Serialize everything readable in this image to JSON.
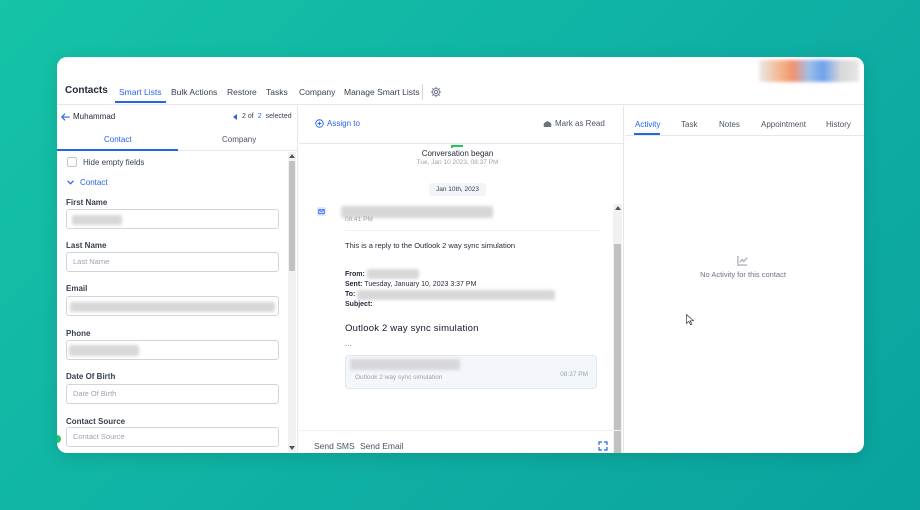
{
  "topnav": {
    "brand": "Contacts",
    "tabs": [
      {
        "label": "Smart Lists",
        "active": true
      },
      {
        "label": "Bulk Actions"
      },
      {
        "label": "Restore"
      },
      {
        "label": "Tasks"
      },
      {
        "label": "Company"
      },
      {
        "label": "Manage Smart Lists"
      }
    ],
    "settings_icon": "gear-icon"
  },
  "left": {
    "back_name": "Muhammad",
    "pager": {
      "current": "2 of",
      "total": "2",
      "selected": "selected"
    },
    "tabs": [
      {
        "label": "Contact",
        "active": true
      },
      {
        "label": "Company"
      }
    ],
    "hide_empty_label": "Hide empty fields",
    "section_label": "Contact",
    "fields": [
      {
        "label": "First Name",
        "value": "",
        "placeholder": ""
      },
      {
        "label": "Last Name",
        "value": "",
        "placeholder": "Last Name"
      },
      {
        "label": "Email",
        "value": "",
        "placeholder": ""
      },
      {
        "label": "Phone",
        "value": "",
        "placeholder": ""
      },
      {
        "label": "Date Of Birth",
        "value": "",
        "placeholder": "Date Of Birth"
      },
      {
        "label": "Contact Source",
        "value": "",
        "placeholder": "Contact Source"
      }
    ]
  },
  "middle": {
    "assign_label": "Assign to",
    "mark_read_label": "Mark as Read",
    "conversation_title": "Conversation began",
    "conversation_time": "Tue, Jan 10 2023, 08:37 PM",
    "date_pill": "Jan 10th, 2023",
    "message": {
      "time": "08:41 PM",
      "body": "This is a reply to the Outlook 2 way sync simulation",
      "from_label": "From:",
      "sent_label": "Sent:",
      "sent_value": "Tuesday, January 10, 2023 3:37 PM",
      "to_label": "To:",
      "subject_label": "Subject:",
      "subject_big": "Outlook 2 way sync simulation",
      "ellipsis": "...",
      "quote_subject": "Outlook 2 way sync simulation",
      "quote_time": "08:37 PM"
    },
    "send_sms": "Send SMS",
    "send_email": "Send Email"
  },
  "right": {
    "tabs": [
      {
        "label": "Activity",
        "active": true
      },
      {
        "label": "Task"
      },
      {
        "label": "Notes"
      },
      {
        "label": "Appointment"
      },
      {
        "label": "History"
      }
    ],
    "empty_text": "No Activity for this contact"
  },
  "colors": {
    "accent": "#2563eb",
    "background": "#12b8a3",
    "success": "#22c55e"
  }
}
